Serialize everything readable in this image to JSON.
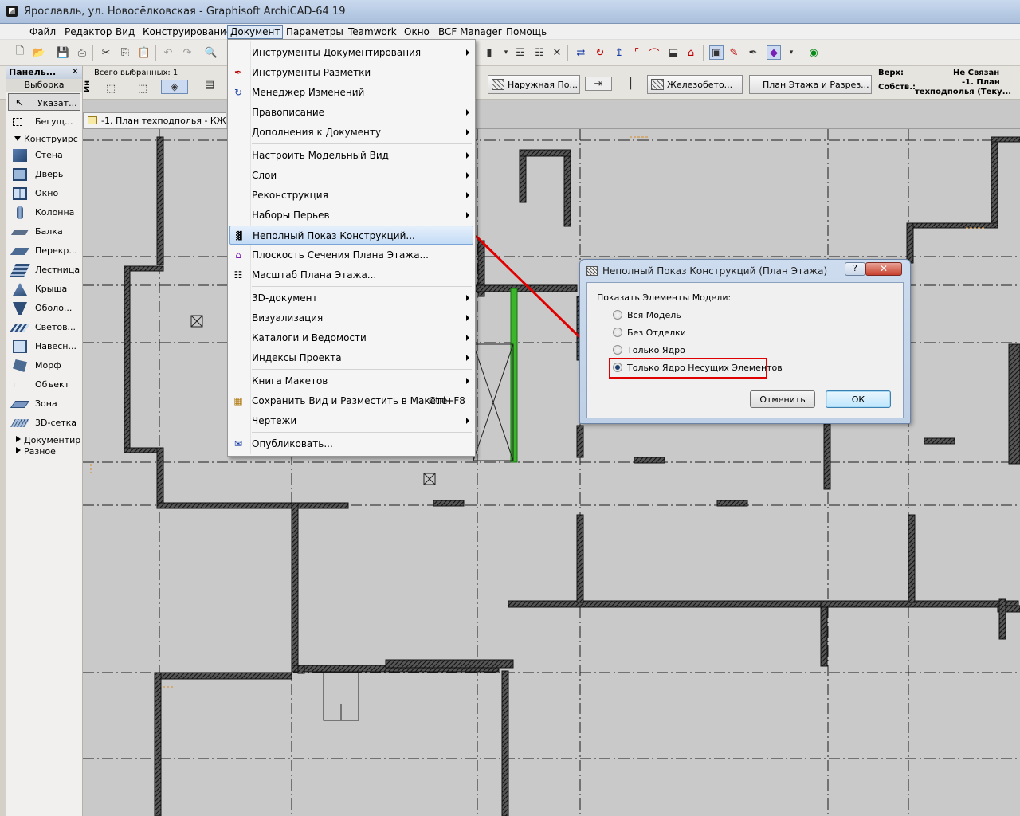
{
  "window": {
    "title": "Ярославль, ул. Новосёлковская - Graphisoft ArchiCAD-64 19"
  },
  "menubar": {
    "items": [
      "Файл",
      "Редактор",
      "Вид",
      "Конструирование",
      "Документ",
      "Параметры",
      "Teamwork",
      "Окно",
      "BCF Manager",
      "Помощь"
    ],
    "open_item": "Документ"
  },
  "infobox": {
    "all_selected": "Всего выбранных: 1",
    "ref_line_label": "Ин",
    "surface_btn": "Наружная По...",
    "material_btn": "Железобето...",
    "view_btn": "План Этажа и Разрез...",
    "top_label": "Верх:",
    "top_value": "Не Связан",
    "own_label": "Собств.:",
    "own_value_1": "-1. План",
    "own_value_2": "техподполья (Теку..."
  },
  "toolbox": {
    "title": "Панель...",
    "selection_tab": "Выборка",
    "pointer": "Указат...",
    "marquee": "Бегущ...",
    "design_group": "Конструирс",
    "tools": [
      "Стена",
      "Дверь",
      "Окно",
      "Колонна",
      "Балка",
      "Перекр...",
      "Лестница",
      "Крыша",
      "Оболо...",
      "Светов...",
      "Навесн...",
      "Морф",
      "Объект",
      "Зона",
      "3D-сетка"
    ],
    "collapsed_groups": [
      "Документир",
      "Разное"
    ]
  },
  "canvas": {
    "tab_label": "-1. План техподполья - КЖ"
  },
  "document_menu": {
    "items": [
      {
        "label": "Инструменты Документирования",
        "submenu": true,
        "icon": ""
      },
      {
        "label": "Инструменты Разметки",
        "submenu": false,
        "icon": "markup-icon"
      },
      {
        "label": "Менеджер Изменений",
        "submenu": false,
        "icon": "change-manager-icon"
      },
      {
        "label": "Правописание",
        "submenu": true,
        "icon": ""
      },
      {
        "label": "Дополнения к Документу",
        "submenu": true,
        "icon": ""
      },
      {
        "label": "Настроить Модельный Вид",
        "submenu": true,
        "icon": ""
      },
      {
        "label": "Слои",
        "submenu": true,
        "icon": ""
      },
      {
        "label": "Реконструкция",
        "submenu": true,
        "icon": ""
      },
      {
        "label": "Наборы Перьев",
        "submenu": true,
        "icon": ""
      },
      {
        "label": "Неполный Показ Конструкций...",
        "submenu": false,
        "icon": "partial-structure-icon"
      },
      {
        "label": "Плоскость Сечения Плана Этажа...",
        "submenu": false,
        "icon": "cut-plane-icon"
      },
      {
        "label": "Масштаб Плана Этажа...",
        "submenu": false,
        "icon": "scale-icon"
      },
      {
        "label": "3D-документ",
        "submenu": true,
        "icon": ""
      },
      {
        "label": "Визуализация",
        "submenu": true,
        "icon": ""
      },
      {
        "label": "Каталоги и Ведомости",
        "submenu": true,
        "icon": ""
      },
      {
        "label": "Индексы Проекта",
        "submenu": true,
        "icon": ""
      },
      {
        "label": "Книга Макетов",
        "submenu": true,
        "icon": ""
      },
      {
        "label": "Сохранить Вид и Разместить в Макете",
        "shortcut": "Ctrl+F8",
        "submenu": false,
        "icon": "save-view-icon"
      },
      {
        "label": "Чертежи",
        "submenu": true,
        "icon": ""
      },
      {
        "label": "Опубликовать...",
        "submenu": false,
        "icon": "publish-icon"
      }
    ],
    "highlighted": "Неполный Показ Конструкций..."
  },
  "dialog": {
    "title": "Неполный Показ Конструкций (План Этажа)",
    "help": "?",
    "close": "✕",
    "group_label": "Показать Элементы Модели:",
    "options": [
      "Вся Модель",
      "Без Отделки",
      "Только Ядро",
      "Только Ядро Несущих Элементов"
    ],
    "selected_option": "Только Ядро Несущих Элементов",
    "cancel": "Отменить",
    "ok": "ОК"
  },
  "colors": {
    "annotation_red": "#e00000",
    "selected_beam_green": "#3bb52a",
    "menu_highlight": "#c4dcf6"
  }
}
